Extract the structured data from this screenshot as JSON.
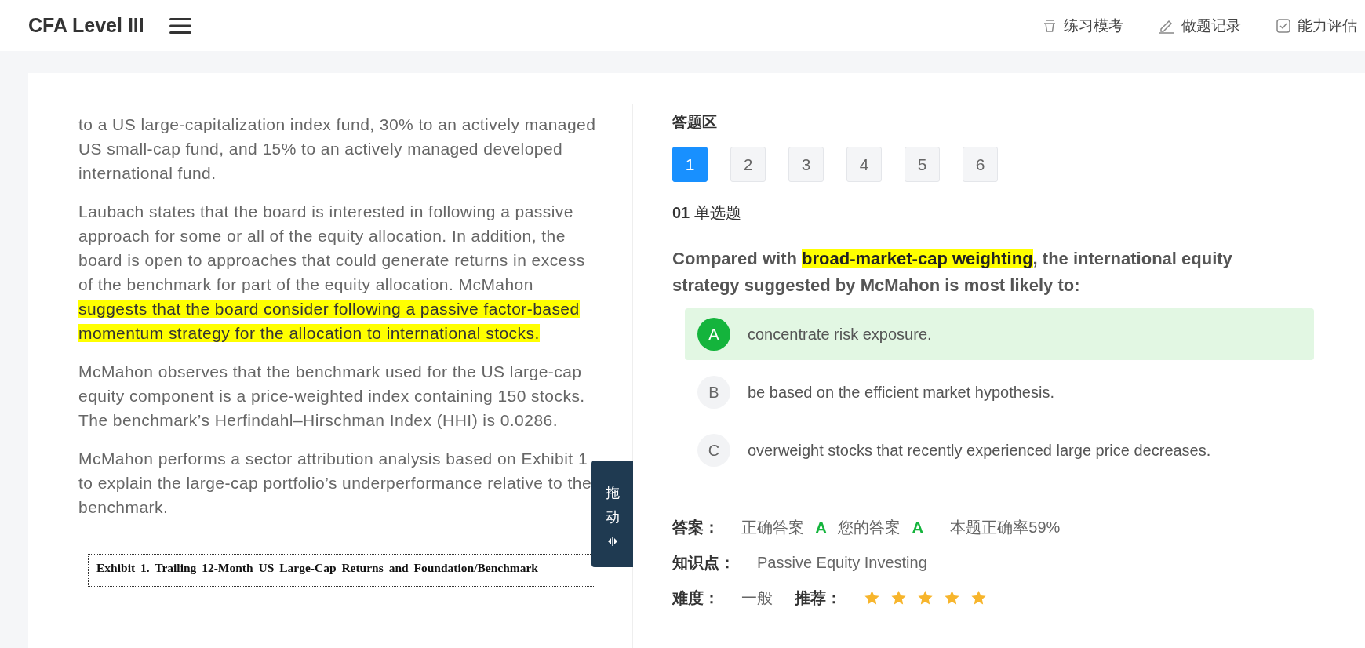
{
  "header": {
    "title": "CFA Level III",
    "nav": [
      {
        "kind": "practice",
        "label": "练习模考"
      },
      {
        "kind": "record",
        "label": "做题记录"
      },
      {
        "kind": "assess",
        "label": "能力评估"
      }
    ]
  },
  "passage": {
    "paragraphs": [
      [
        {
          "text": "to a US large-capitalization index fund, 30% to an actively managed US small-cap fund, and 15% to an actively managed developed international fund.",
          "highlighted": false
        }
      ],
      [
        {
          "text": "Laubach states that the board is interested in following a passive approach for some or all of the equity allocation. In addition, the board is open to approaches that could generate returns in excess of the benchmark for part of the equity allocation. McMahon ",
          "highlighted": false
        },
        {
          "text": "suggests that the board consider following a passive factor-based momentum strategy for the allocation to international stocks.",
          "highlighted": true
        }
      ],
      [
        {
          "text": "McMahon observes that the benchmark used for the US large-cap equity component is a price-weighted index containing 150 stocks. The benchmark’s Herfindahl–Hirschman Index (HHI) is 0.0286.",
          "highlighted": false
        }
      ],
      [
        {
          "text": "McMahon performs a sector attribution analysis based on Exhibit 1 to explain the large-cap portfolio’s underperformance relative to the benchmark.",
          "highlighted": false
        }
      ]
    ],
    "exhibit": {
      "title": "Exhibit 1. Trailing 12-Month US Large-Cap Returns and Foundation/Benchmark"
    }
  },
  "drag_handle": {
    "label": "拖动"
  },
  "answer_area": {
    "title": "答题区",
    "questions": [
      {
        "label": "1",
        "selected": true
      },
      {
        "label": "2",
        "selected": false
      },
      {
        "label": "3",
        "selected": false
      },
      {
        "label": "4",
        "selected": false
      },
      {
        "label": "5",
        "selected": false
      },
      {
        "label": "6",
        "selected": false
      }
    ],
    "question_number": "01",
    "question_type": "单选题",
    "stem": [
      {
        "text": "Compared with ",
        "highlighted": false
      },
      {
        "text": "broad-market-cap weighting",
        "highlighted": true
      },
      {
        "text": ", the international equity strategy suggested by McMahon is most likely to:",
        "highlighted": false
      }
    ],
    "options": [
      {
        "letter": "A",
        "text": "concentrate risk exposure.",
        "selected": true
      },
      {
        "letter": "B",
        "text": "be based on the efficient market hypothesis.",
        "selected": false
      },
      {
        "letter": "C",
        "text": "overweight stocks that recently experienced large price decreases.",
        "selected": false
      }
    ],
    "answer": {
      "label": "答案：",
      "correct_label": "正确答案",
      "correct": "A",
      "yours_label": "您的答案",
      "yours": "A",
      "rate": "本题正确率59%"
    },
    "knowledge": {
      "label": "知识点：",
      "value": "Passive Equity Investing"
    },
    "difficulty": {
      "label": "难度：",
      "value": "一般"
    },
    "recommend": {
      "label": "推荐：",
      "stars": 5
    }
  }
}
